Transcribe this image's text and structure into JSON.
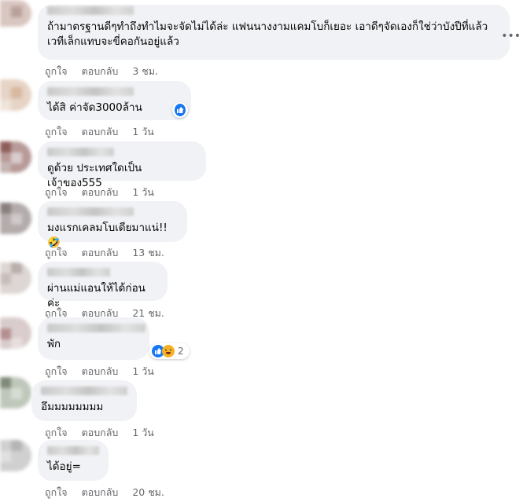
{
  "comments": [
    {
      "text": "ถ้ามาตรฐานดีๆทำถึงทำไมจะจัดไม่ได้ล่ะ แฟนนางงามแคมโบก็เยอะ เอาดีๆจัดเองก็ใช่ว่าบังปีที่แล้ว\nเวทีเล็กแทบจะขี่คอกันอยู่แล้ว",
      "like": "ถูกใจ",
      "reply": "ตอบกลับ",
      "time": "3 ชม."
    },
    {
      "text": "ได้สิ ค่าจัด3000ล้าน",
      "like": "ถูกใจ",
      "reply": "ตอบกลับ",
      "time": "1 วัน"
    },
    {
      "text": "ดูด้วย ประเทศใดเป็นเจ้าของ555",
      "like": "ถูกใจ",
      "reply": "ตอบกลับ",
      "time": "1 วัน"
    },
    {
      "text": "มงแรกเคลมโบเดียมาแน่!!🤣",
      "like": "ถูกใจ",
      "reply": "ตอบกลับ",
      "time": "13 ชม."
    },
    {
      "text": "ผ่านแม่แอนให้ได้ก่อนค่ะ",
      "like": "ถูกใจ",
      "reply": "ตอบกลับ",
      "time": "21 ชม."
    },
    {
      "text": "พัก",
      "like": "ถูกใจ",
      "reply": "ตอบกลับ",
      "time": "1 วัน",
      "reaction_count": "2"
    },
    {
      "text": "อึมมมมมมมม",
      "like": "ถูกใจ",
      "reply": "ตอบกลับ",
      "time": "1 วัน"
    },
    {
      "text": "ได้อยู่=",
      "like": "ถูกใจ",
      "reply": "ตอบกลับ",
      "time": "20 ชม."
    }
  ],
  "colors": {
    "bubble": "#f0f2f5",
    "meta": "#65676b",
    "like_blue": "#1877f2",
    "haha_yellow": "#f7b125"
  },
  "icons": {
    "more": "more-options-icon",
    "like_reaction": "like-reaction-icon",
    "haha_reaction": "haha-reaction-icon"
  }
}
